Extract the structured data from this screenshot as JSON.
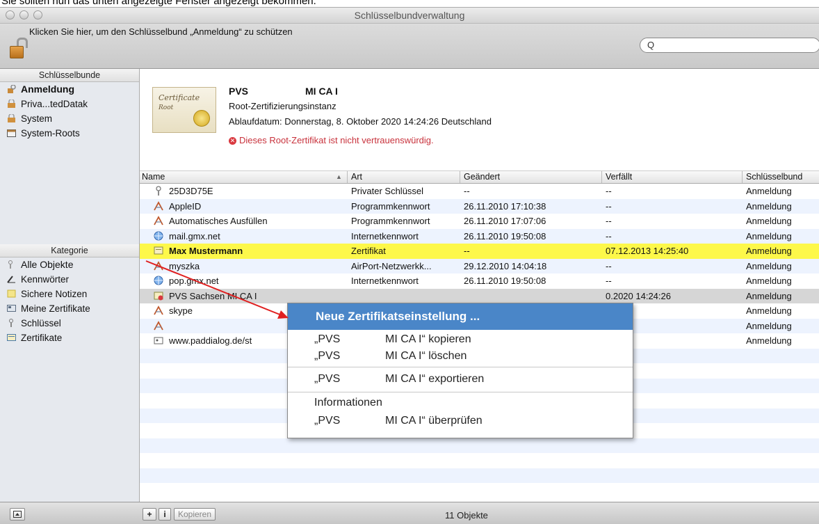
{
  "caption": "Sie sollten nun das unten angezeigte Fenster angezeigt bekommen.",
  "window": {
    "title": "Schlüsselbundverwaltung"
  },
  "toolbar": {
    "lock_text": "Klicken Sie hier, um den Schlüsselbund „Anmeldung“ zu schützen",
    "search_icon": "Q"
  },
  "sidebar": {
    "keychains_header": "Schlüsselbunde",
    "keychains": [
      {
        "label": "Anmeldung",
        "icon": "keychain-icon",
        "bold": true
      },
      {
        "label": "Priva...tedDatak",
        "icon": "lock-icon"
      },
      {
        "label": "System",
        "icon": "lock-icon"
      },
      {
        "label": "System-Roots",
        "icon": "folder-icon"
      }
    ],
    "category_header": "Kategorie",
    "categories": [
      {
        "label": "Alle Objekte",
        "icon": "all-items-icon"
      },
      {
        "label": "Kennwörter",
        "icon": "passwords-icon"
      },
      {
        "label": "Sichere Notizen",
        "icon": "note-icon"
      },
      {
        "label": "Meine Zertifikate",
        "icon": "my-cert-icon"
      },
      {
        "label": "Schlüssel",
        "icon": "key-icon"
      },
      {
        "label": "Zertifikate",
        "icon": "certificate-icon"
      }
    ]
  },
  "info": {
    "name_a": "PVS",
    "name_b": "MI CA I",
    "kind": "Root-Zertifizierungsinstanz",
    "expiry": "Ablaufdatum: Donnerstag, 8. Oktober 2020 14:24:26 Deutschland",
    "warning": "Dieses Root-Zertifikat ist nicht vertrauenswürdig.",
    "cert_script": "Certificate",
    "cert_script2": "Root"
  },
  "table": {
    "headers": {
      "name": "Name",
      "sort": "▲",
      "kind": "Art",
      "changed": "Geändert",
      "expires": "Verfällt",
      "keychain": "Schlüsselbund"
    },
    "rows": [
      {
        "name": "25D3D75E",
        "kind": "Privater Schlüssel",
        "changed": "--",
        "expires": "--",
        "keychain": "Anmeldung",
        "icon": "key-icon"
      },
      {
        "name": "AppleID",
        "kind": "Programmkennwort",
        "changed": "26.11.2010 17:10:38",
        "expires": "--",
        "keychain": "Anmeldung",
        "icon": "app-password-icon"
      },
      {
        "name": "Automatisches Ausfüllen",
        "kind": "Programmkennwort",
        "changed": "26.11.2010 17:07:06",
        "expires": "--",
        "keychain": "Anmeldung",
        "icon": "app-password-icon"
      },
      {
        "name": "mail.gmx.net",
        "kind": "Internetkennwort",
        "changed": "26.11.2010 19:50:08",
        "expires": "--",
        "keychain": "Anmeldung",
        "icon": "globe-icon"
      },
      {
        "name": "Max Mustermann",
        "kind": "Zertifikat",
        "changed": "--",
        "expires": "07.12.2013 14:25:40",
        "keychain": "Anmeldung",
        "icon": "certificate-icon"
      },
      {
        "name": "myszka",
        "kind": "AirPort-Netzwerkk...",
        "changed": "29.12.2010 14:04:18",
        "expires": "--",
        "keychain": "Anmeldung",
        "icon": "app-password-icon"
      },
      {
        "name": "pop.gmx.net",
        "kind": "Internetkennwort",
        "changed": "26.11.2010 19:50:08",
        "expires": "--",
        "keychain": "Anmeldung",
        "icon": "globe-icon"
      },
      {
        "name": "PVS Sachsen MI CA I",
        "kind": "",
        "changed": "",
        "expires": "0.2020 14:24:26",
        "keychain": "Anmeldung",
        "icon": "cert-invalid-icon"
      },
      {
        "name": "skype",
        "kind": "",
        "changed": "",
        "expires": "",
        "keychain": "Anmeldung",
        "icon": "app-password-icon"
      },
      {
        "name": "",
        "kind": "",
        "changed": "",
        "expires": "",
        "keychain": "Anmeldung",
        "icon": "app-password-icon"
      },
      {
        "name": "www.paddialog.de/st",
        "kind": "",
        "changed": "",
        "expires": "",
        "keychain": "Anmeldung",
        "icon": "web-form-icon"
      }
    ]
  },
  "context_menu": {
    "highlighted": "Neue Zertifikatseinstellung ...",
    "copy_a": "„PVS",
    "copy_b": "MI CA I“ kopieren",
    "delete_a": "„PVS",
    "delete_b": "MI CA I“ löschen",
    "export_a": "„PVS",
    "export_b": "MI CA I“ exportieren",
    "info": "Informationen",
    "verify_a": "„PVS",
    "verify_b": "MI CA I“ überprüfen"
  },
  "bottombar": {
    "add": "+",
    "info": "i",
    "copy": "Kopieren",
    "count": "11 Objekte"
  },
  "colors": {
    "highlight_row": "#fdf84a",
    "menu_highlight": "#4a86c8",
    "warning": "#c8323c",
    "arrow": "#e02020"
  }
}
